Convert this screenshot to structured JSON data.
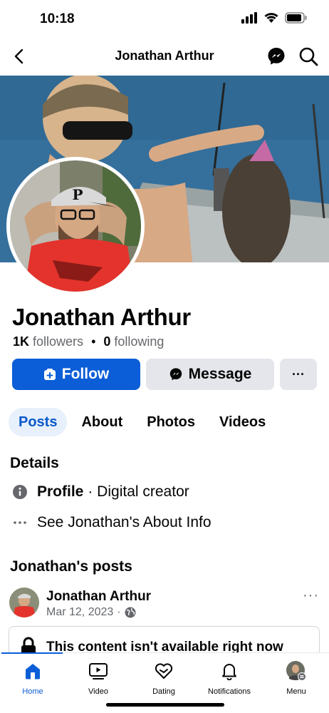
{
  "status": {
    "time": "10:18"
  },
  "header": {
    "title": "Jonathan Arthur"
  },
  "profile": {
    "name": "Jonathan Arthur",
    "followers_count": "1K",
    "followers_label": "followers",
    "separator": "•",
    "following_count": "0",
    "following_label": "following"
  },
  "actions": {
    "follow": "Follow",
    "message": "Message",
    "more": "···"
  },
  "tabs": [
    {
      "label": "Posts",
      "active": true
    },
    {
      "label": "About"
    },
    {
      "label": "Photos"
    },
    {
      "label": "Videos"
    }
  ],
  "details": {
    "title": "Details",
    "profile_label": "Profile",
    "profile_value": "· Digital creator",
    "about_link": "See Jonathan's About Info"
  },
  "posts": {
    "title": "Jonathan's posts",
    "author": "Jonathan Arthur",
    "date": "Mar 12, 2023",
    "meta_sep": "·",
    "unavailable": "This content isn't available right now"
  },
  "bottom_nav": [
    {
      "label": "Home",
      "icon": "home-icon",
      "active": true
    },
    {
      "label": "Video",
      "icon": "video-icon"
    },
    {
      "label": "Dating",
      "icon": "dating-icon"
    },
    {
      "label": "Notifications",
      "icon": "bell-icon"
    },
    {
      "label": "Menu",
      "icon": "menu-avatar-icon"
    }
  ],
  "colors": {
    "accent": "#0b5ed7",
    "secondary_button": "#e4e6eb",
    "muted_text": "#65676b",
    "active_tab_bg": "#e7f0fb"
  }
}
